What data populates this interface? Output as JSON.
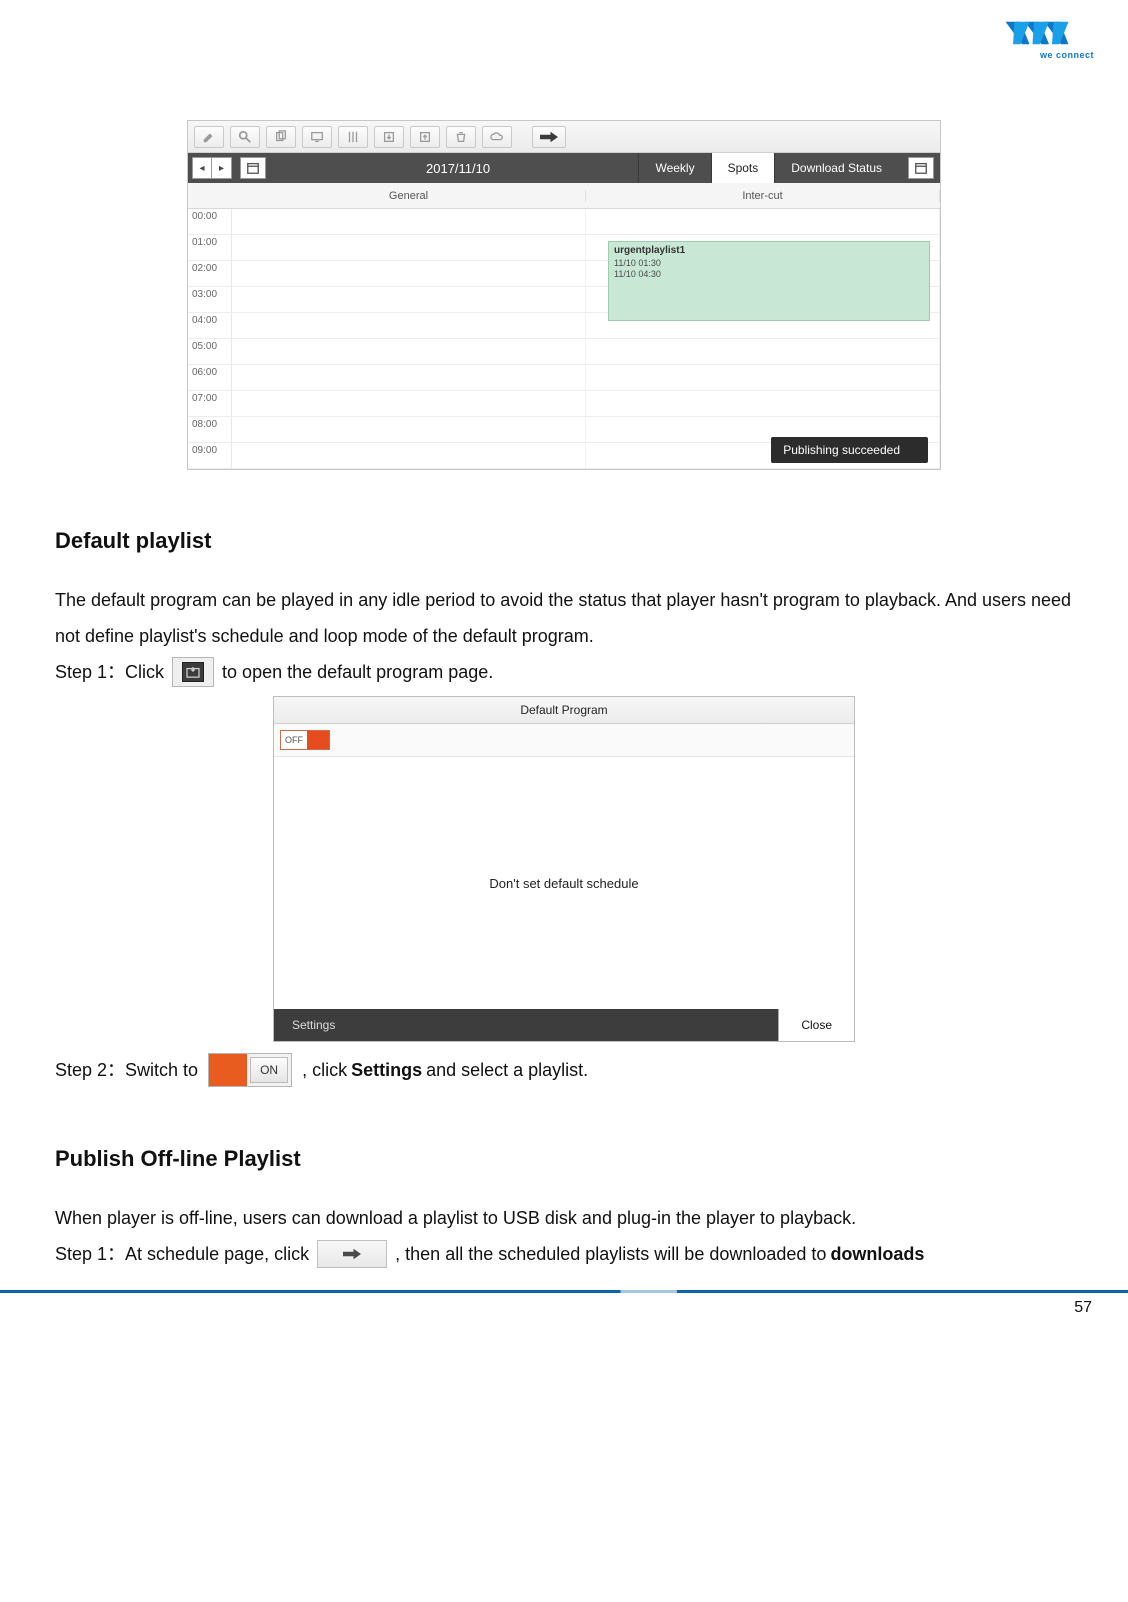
{
  "logo_tagline": "we connect",
  "page_number": "57",
  "section1_title": "Default playlist",
  "section1_para": "The default program can be played in any idle period to avoid the status that player hasn't program to playback. And users need not define playlist's schedule and loop mode of the default program.",
  "step1a_pre": "Step 1：Click",
  "step1a_post": " to open the default program page.",
  "step2a_pre": "Step 2：Switch to ",
  "step2a_mid": " , click ",
  "step2a_bold": "Settings",
  "step2a_post": " and select a playlist.",
  "toggle_on_label": "ON",
  "section2_title": "Publish Off-line Playlist",
  "section2_para": "When player is off-line, users can download a playlist to USB disk and plug-in the player to playback.",
  "step1b_pre": "Step 1：At schedule page, click ",
  "step1b_post": ", then all the scheduled playlists will be downloaded to ",
  "step1b_bold": "downloads",
  "shot1": {
    "date": "2017/11/10",
    "tabs": {
      "weekly": "Weekly",
      "spots": "Spots",
      "download": "Download Status"
    },
    "cols": {
      "general": "General",
      "intercut": "Inter-cut"
    },
    "times": [
      "00:00",
      "01:00",
      "02:00",
      "03:00",
      "04:00",
      "05:00",
      "06:00",
      "07:00",
      "08:00",
      "09:00"
    ],
    "event": {
      "title": "urgentplaylist1",
      "line1": "11/10 01:30",
      "line2": "11/10 04:30"
    },
    "toast": "Publishing succeeded"
  },
  "shot2": {
    "title": "Default Program",
    "off_label": "OFF",
    "body_text": "Don't set default schedule",
    "settings": "Settings",
    "close": "Close"
  }
}
